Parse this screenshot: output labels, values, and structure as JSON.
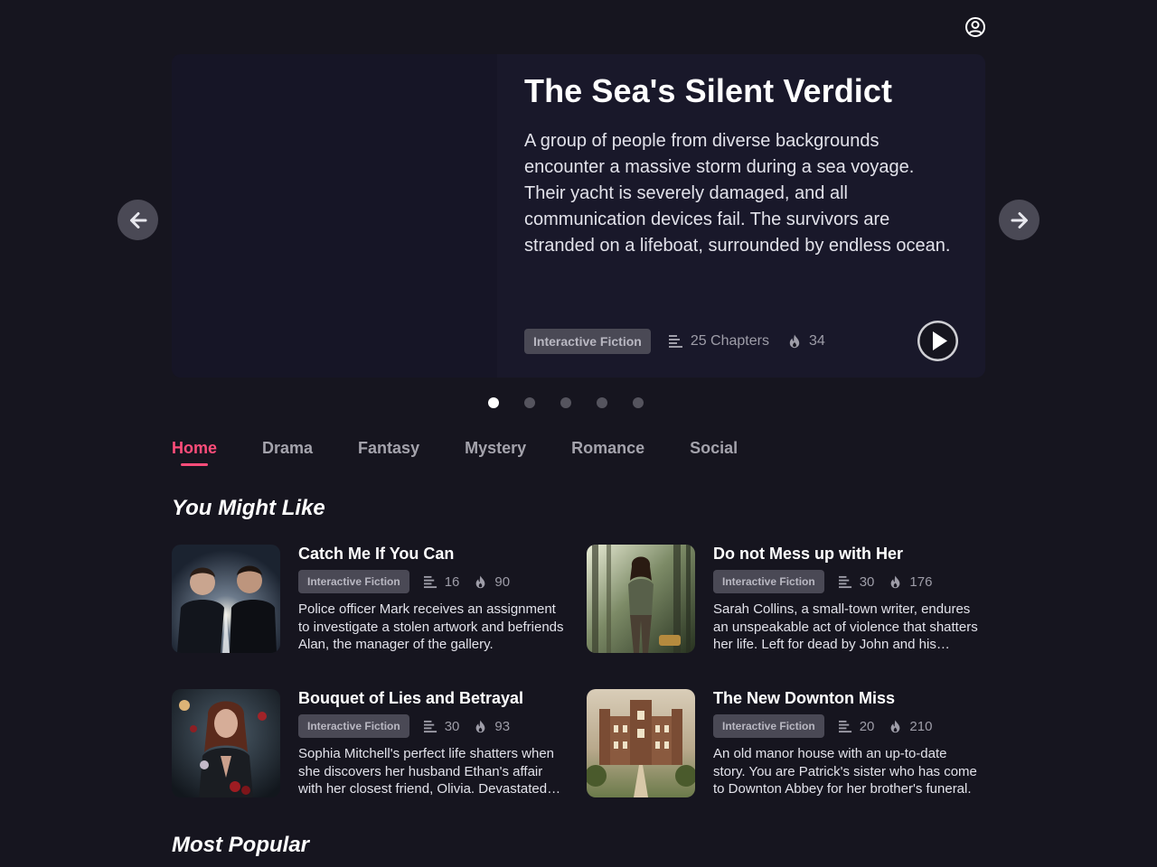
{
  "featured": {
    "title": "The Sea's Silent Verdict",
    "description": "A group of people from diverse backgrounds encounter a massive storm during a sea voyage. Their yacht is severely damaged, and all communication devices fail. The survivors are stranded on a lifeboat, surrounded by endless ocean.",
    "tag": "Interactive Fiction",
    "chapters": "25 Chapters",
    "popularity": "34",
    "slides_total": 5,
    "active_slide": 1
  },
  "icons": {
    "profile": "user-circle-icon",
    "prev": "arrow-left-icon",
    "next": "arrow-right-icon",
    "play": "play-icon",
    "chapters": "list-lines-icon",
    "popularity": "flame-icon"
  },
  "tabs": [
    {
      "label": "Home",
      "active": true
    },
    {
      "label": "Drama"
    },
    {
      "label": "Fantasy"
    },
    {
      "label": "Mystery"
    },
    {
      "label": "Romance"
    },
    {
      "label": "Social"
    }
  ],
  "sections": {
    "you_might_like": "You Might Like",
    "most_popular": "Most Popular"
  },
  "stories": [
    {
      "title": "Catch Me If You Can",
      "tag": "Interactive Fiction",
      "chapters": "16",
      "popularity": "90",
      "description": "Police officer Mark receives an assignment to investigate a stolen artwork and befriends Alan, the manager of the gallery."
    },
    {
      "title": "Do not Mess up with Her",
      "tag": "Interactive Fiction",
      "chapters": "30",
      "popularity": "176",
      "description": "Sarah Collins, a small-town writer, endures an unspeakable act of violence that shatters her life. Left for dead by John and his friends."
    },
    {
      "title": "Bouquet of Lies and Betrayal",
      "tag": "Interactive Fiction",
      "chapters": "30",
      "popularity": "93",
      "description": "Sophia Mitchell's perfect life shatters when she discovers her husband Ethan's affair with her closest friend, Olivia. Devastated and betrayed."
    },
    {
      "title": "The New Downton Miss",
      "tag": "Interactive Fiction",
      "chapters": "20",
      "popularity": "210",
      "description": "An old manor house with an up-to-date story. You are Patrick's sister who has come to Downton Abbey for her brother's funeral."
    }
  ]
}
